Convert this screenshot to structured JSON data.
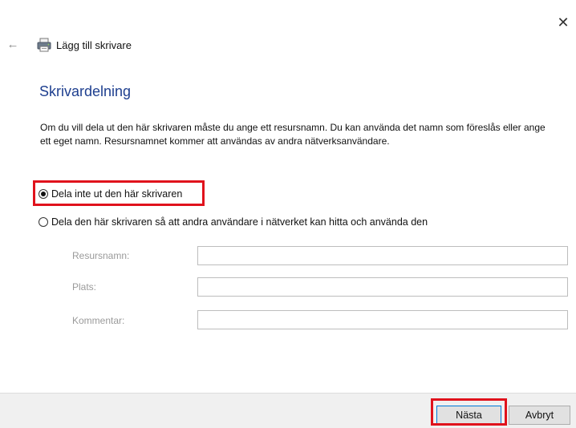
{
  "window": {
    "title": "Lägg till skrivare",
    "close_label": "✕"
  },
  "main": {
    "heading": "Skrivardelning",
    "description": "Om du vill dela ut den här skrivaren måste du ange ett resursnamn. Du kan använda det namn som föreslås eller ange ett eget namn. Resursnamnet kommer att användas av andra nätverksanvändare.",
    "options": [
      {
        "label": "Dela inte ut den här skrivaren",
        "selected": true
      },
      {
        "label": "Dela den här skrivaren så att andra användare i nätverket kan hitta och använda den",
        "selected": false
      }
    ],
    "fields": [
      {
        "label": "Resursnamn:",
        "value": ""
      },
      {
        "label": "Plats:",
        "value": ""
      },
      {
        "label": "Kommentar:",
        "value": ""
      }
    ]
  },
  "footer": {
    "next_label": "Nästa",
    "cancel_label": "Avbryt"
  },
  "colors": {
    "heading": "#1e3f8f",
    "highlight": "#e0121c",
    "accent": "#0078d7"
  }
}
